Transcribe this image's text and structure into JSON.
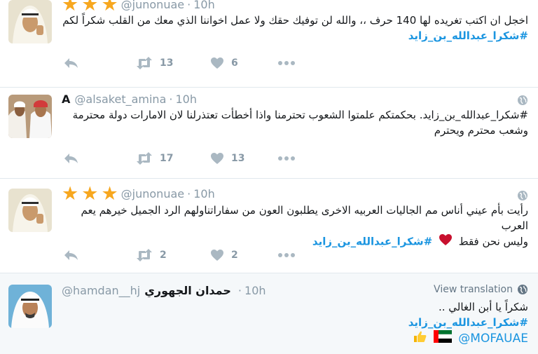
{
  "tweets": [
    {
      "handle": "@junonuae",
      "time": "10h",
      "stars": 3,
      "lines": [
        "اخجل ان اكتب تغريده لها 140 حرف ،، والله لن توفيك حقك ولا عمل اخواننا الذي معك من القلب شكراً لكم"
      ],
      "hashtag": "#شكرا_عبدالله_بن_زايد",
      "retweets": "13",
      "likes": "6"
    },
    {
      "name_letter": "A",
      "handle": "@alsaket_amina",
      "time": "10h",
      "lines": [
        "#شكرا_عبدالله_بن_زايد.  بحكمتكم علمتوا الشعوب تحترمنا واذا أخطأت تعتذرلنا لان الامارات دولة محترمة",
        "وشعب محترم ويحترم"
      ],
      "retweets": "17",
      "likes": "13"
    },
    {
      "handle": "@junonuae",
      "time": "10h",
      "stars": 3,
      "lines": [
        "رأيت بأم عيني أناس مم الجاليات العربيه الاخرى يطلبون العون من سفاراتناولهم الرد الجميل خيرهم يعم العرب",
        "وليس نحن فقط"
      ],
      "hashtag": "#شكرا_عبدالله_بن_زايد",
      "retweets": "2",
      "likes": "2"
    },
    {
      "name": "حمدان الجهوري",
      "handle": "@hamdan__hj",
      "time": "10h",
      "view_translation": "View translation",
      "lines": [
        "شكراً يا أبن الغالي ..",
        "#شكرا_عبدالله_بن_زايد"
      ],
      "mention": "@MOFAUAE"
    }
  ],
  "icons": {
    "reply": "reply-icon",
    "retweet": "retweet-icon",
    "like": "heart-icon",
    "more": "more-icon",
    "globe": "globe-icon"
  },
  "colors": {
    "link": "#1b95e0",
    "star": "#f7a71f",
    "muted": "#8899a6",
    "highlight_bg": "#f5f8fa"
  }
}
